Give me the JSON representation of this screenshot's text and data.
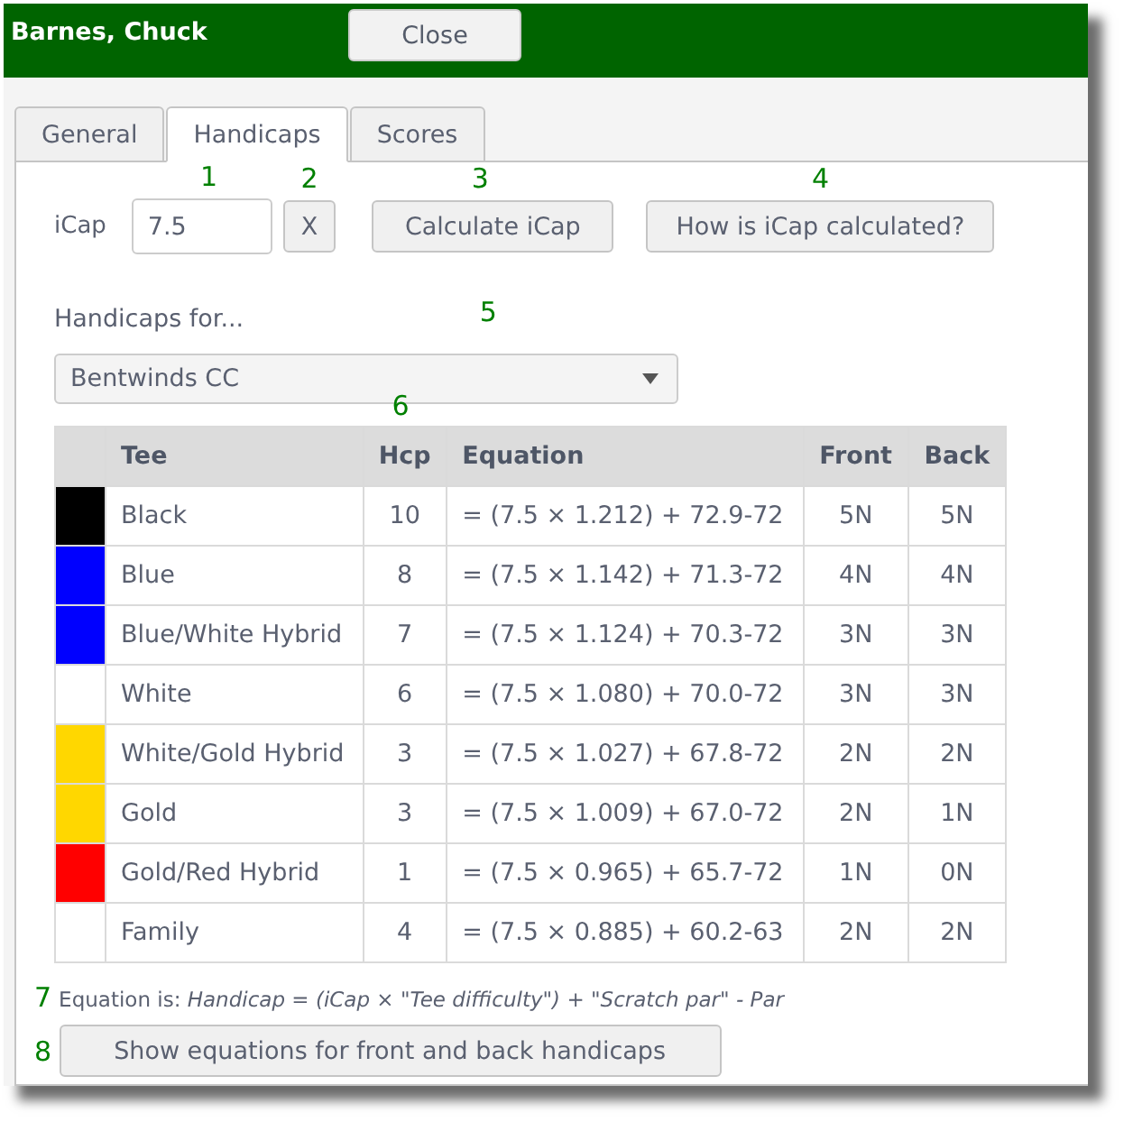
{
  "window": {
    "title": "Barnes, Chuck",
    "close_button": "Close"
  },
  "tabs": [
    {
      "label": "General",
      "selected": false
    },
    {
      "label": "Handicaps",
      "selected": true
    },
    {
      "label": "Scores",
      "selected": false
    }
  ],
  "icap": {
    "label": "iCap",
    "value": "7.5",
    "callout": "1",
    "clear_button": {
      "label": "X",
      "callout": "2"
    },
    "calculate_button": {
      "label": "Calculate iCap",
      "callout": "3"
    },
    "help_button": {
      "label": "How is iCap calculated?",
      "callout": "4"
    }
  },
  "course": {
    "label": "Handicaps for...",
    "value": "Bentwinds CC",
    "callout": "5"
  },
  "table": {
    "columns": [
      "Tee",
      "Hcp",
      "Equation",
      "Front",
      "Back"
    ],
    "hcp_callout": "6",
    "rows": [
      {
        "color": "#000000",
        "tee": "Black",
        "hcp": "10",
        "equation": "= (7.5 × 1.212) + 72.9-72",
        "front": "5N",
        "back": "5N"
      },
      {
        "color": "#0000ff",
        "tee": "Blue",
        "hcp": "8",
        "equation": "= (7.5 × 1.142) + 71.3-72",
        "front": "4N",
        "back": "4N"
      },
      {
        "color": "#0000ff",
        "tee": "Blue/White Hybrid",
        "hcp": "7",
        "equation": "= (7.5 × 1.124) + 70.3-72",
        "front": "3N",
        "back": "3N"
      },
      {
        "color": "#ffffff",
        "tee": "White",
        "hcp": "6",
        "equation": "= (7.5 × 1.080) + 70.0-72",
        "front": "3N",
        "back": "3N"
      },
      {
        "color": "#ffd700",
        "tee": "White/Gold Hybrid",
        "hcp": "3",
        "equation": "= (7.5 × 1.027) + 67.8-72",
        "front": "2N",
        "back": "2N"
      },
      {
        "color": "#ffd700",
        "tee": "Gold",
        "hcp": "3",
        "equation": "= (7.5 × 1.009) + 67.0-72",
        "front": "2N",
        "back": "1N"
      },
      {
        "color": "#ff0000",
        "tee": "Gold/Red Hybrid",
        "hcp": "1",
        "equation": "= (7.5 × 0.965) + 65.7-72",
        "front": "1N",
        "back": "0N"
      },
      {
        "color": "#ffffff",
        "tee": "Family",
        "hcp": "4",
        "equation": "= (7.5 × 0.885) + 60.2-63",
        "front": "2N",
        "back": "2N"
      }
    ]
  },
  "equation_note": {
    "callout": "7",
    "text": "Equation is: *Handicap = (iCap × \"Tee difficulty\") + \"Scratch par\" - Par*"
  },
  "show_equations": {
    "callout": "8",
    "label": "Show equations for front and back handicaps"
  }
}
